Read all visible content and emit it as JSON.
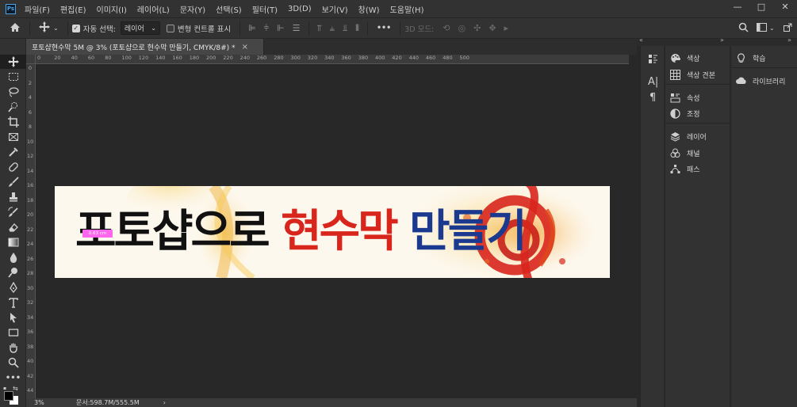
{
  "app": {
    "logo": "Ps"
  },
  "menu": [
    "파일(F)",
    "편집(E)",
    "이미지(I)",
    "레이어(L)",
    "문자(Y)",
    "선택(S)",
    "필터(T)",
    "3D(D)",
    "보기(V)",
    "창(W)",
    "도움말(H)"
  ],
  "window_controls": {
    "minimize": "—",
    "maximize": "□",
    "close": "✕"
  },
  "options": {
    "auto_select_label": "자동 선택:",
    "auto_select_value": "레이어",
    "transform_label": "변형 컨트롤 표시",
    "mode_3d_label": "3D 모드:",
    "more": "•••"
  },
  "document": {
    "tab_title": "포토샵현수막 5M @ 3% (포토샵으로 현수막 만들기, CMYK/8#) *",
    "close": "×"
  },
  "ruler_h": [
    "0",
    "20",
    "40",
    "60",
    "80",
    "100",
    "120",
    "140",
    "160",
    "180",
    "200",
    "220",
    "240",
    "260",
    "280",
    "300",
    "320",
    "340",
    "360",
    "380",
    "400",
    "420",
    "440",
    "460",
    "480",
    "500"
  ],
  "ruler_v": [
    "0",
    "2",
    "4",
    "6",
    "8",
    "10",
    "12",
    "14",
    "16",
    "18",
    "20",
    "22",
    "24",
    "26",
    "28",
    "30",
    "32",
    "34",
    "36",
    "38",
    "40",
    "42",
    "44"
  ],
  "banner": {
    "text_black": "포토샵으로 ",
    "text_red": "현수막",
    "text_blue": " 만들기",
    "colors": {
      "black": "#111111",
      "red": "#d8261d",
      "blue": "#1b3a8f"
    }
  },
  "measure_tooltip": "0.63 cm",
  "status": {
    "zoom": "3%",
    "doc_size": "문서:598.7M/555.5M",
    "arrow": "›"
  },
  "panels": {
    "group1": [
      "색상",
      "색상 견본"
    ],
    "group2": [
      "속성",
      "조정"
    ],
    "group3": [
      "레이어",
      "채널",
      "패스"
    ],
    "group_b": [
      "학습",
      "라이브러리"
    ]
  }
}
